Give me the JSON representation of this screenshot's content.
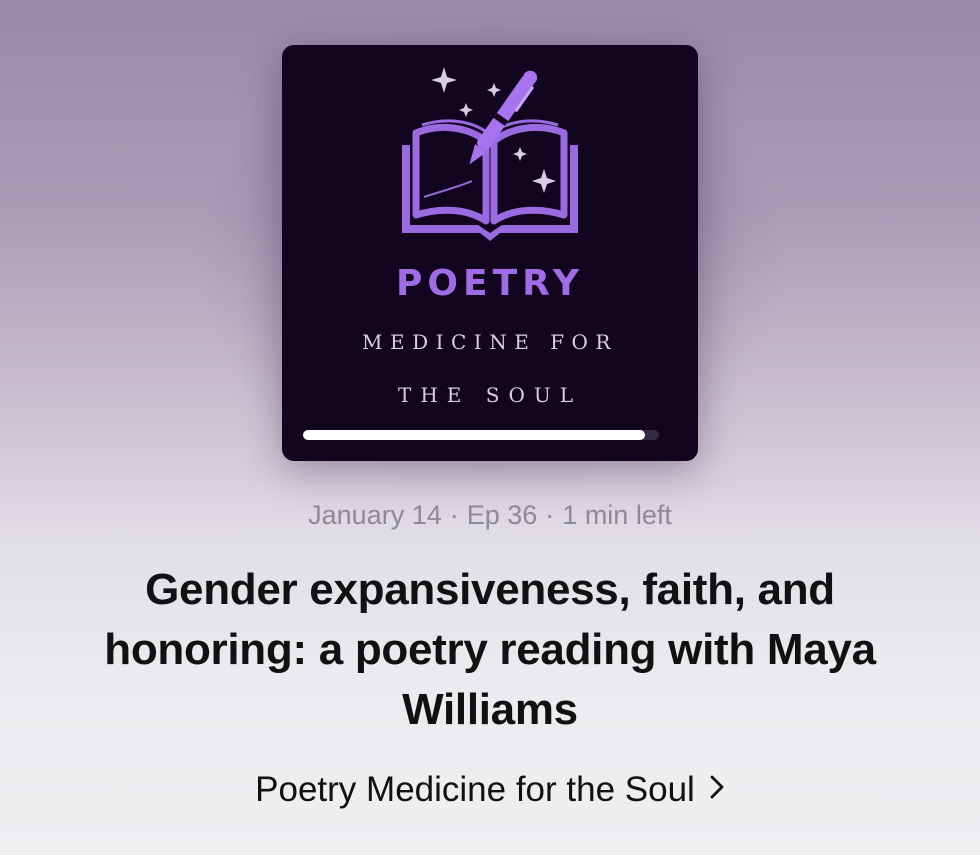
{
  "artwork": {
    "title": "POETRY",
    "subtitle_line1": "MEDICINE FOR",
    "subtitle_line2": "THE SOUL",
    "progress_fraction": 0.96,
    "accent_color": "#a06ce6",
    "background_color": "#120520"
  },
  "episode": {
    "date": "January 14",
    "episode_number": "Ep 36",
    "time_left": "1 min left",
    "separator": "·",
    "title": "Gender expansiveness, faith, and honoring: a poetry reading with Maya Williams"
  },
  "show": {
    "name": "Poetry Medicine for the Soul",
    "chevron_icon": "chevron-right-icon"
  }
}
